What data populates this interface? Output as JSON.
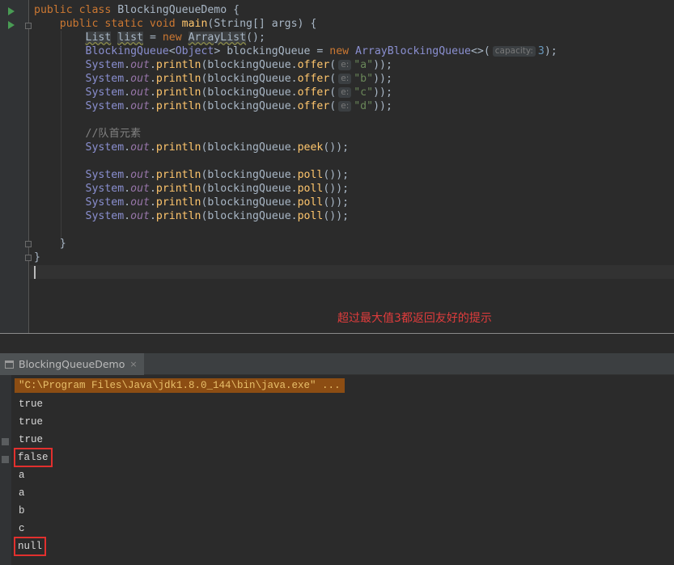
{
  "editor": {
    "lines": [
      {
        "parts": [
          [
            "kw",
            "public class "
          ],
          [
            "type",
            "BlockingQueueDemo "
          ],
          [
            "type",
            "{"
          ]
        ]
      },
      {
        "parts": [
          [
            "kw",
            "    public static void "
          ],
          [
            "method",
            "main"
          ],
          [
            "type",
            "("
          ],
          [
            "type",
            "String"
          ],
          [
            "type",
            "[] args) {"
          ]
        ]
      },
      {
        "parts": [
          [
            "type",
            "        "
          ],
          [
            "warn",
            "List"
          ],
          [
            "type",
            " "
          ],
          [
            "warn",
            "list"
          ],
          [
            "type",
            " = "
          ],
          [
            "kw",
            "new "
          ],
          [
            "warn",
            "ArrayList"
          ],
          [
            "type",
            "();"
          ]
        ]
      },
      {
        "parts": [
          [
            "type",
            "        "
          ],
          [
            "cls",
            "BlockingQueue"
          ],
          [
            "type",
            "<"
          ],
          [
            "gen",
            "Object"
          ],
          [
            "type",
            "> blockingQueue = "
          ],
          [
            "kw",
            "new "
          ],
          [
            "cls",
            "ArrayBlockingQueue"
          ],
          [
            "type",
            "<>("
          ],
          [
            "hint",
            "capacity:"
          ],
          [
            "num",
            "3"
          ],
          [
            "type",
            ");"
          ]
        ]
      },
      {
        "parts": [
          [
            "type",
            "        "
          ],
          [
            "cls",
            "System"
          ],
          [
            "type",
            "."
          ],
          [
            "field",
            "out"
          ],
          [
            "type",
            "."
          ],
          [
            "method",
            "println"
          ],
          [
            "type",
            "(blockingQueue."
          ],
          [
            "method",
            "offer"
          ],
          [
            "type",
            "("
          ],
          [
            "hint",
            "e:"
          ],
          [
            "str",
            "\"a\""
          ],
          [
            "type",
            "));"
          ]
        ]
      },
      {
        "parts": [
          [
            "type",
            "        "
          ],
          [
            "cls",
            "System"
          ],
          [
            "type",
            "."
          ],
          [
            "field",
            "out"
          ],
          [
            "type",
            "."
          ],
          [
            "method",
            "println"
          ],
          [
            "type",
            "(blockingQueue."
          ],
          [
            "method",
            "offer"
          ],
          [
            "type",
            "("
          ],
          [
            "hint",
            "e:"
          ],
          [
            "str",
            "\"b\""
          ],
          [
            "type",
            "));"
          ]
        ]
      },
      {
        "parts": [
          [
            "type",
            "        "
          ],
          [
            "cls",
            "System"
          ],
          [
            "type",
            "."
          ],
          [
            "field",
            "out"
          ],
          [
            "type",
            "."
          ],
          [
            "method",
            "println"
          ],
          [
            "type",
            "(blockingQueue."
          ],
          [
            "method",
            "offer"
          ],
          [
            "type",
            "("
          ],
          [
            "hint",
            "e:"
          ],
          [
            "str",
            "\"c\""
          ],
          [
            "type",
            "));"
          ]
        ]
      },
      {
        "parts": [
          [
            "type",
            "        "
          ],
          [
            "cls",
            "System"
          ],
          [
            "type",
            "."
          ],
          [
            "field",
            "out"
          ],
          [
            "type",
            "."
          ],
          [
            "method",
            "println"
          ],
          [
            "type",
            "(blockingQueue."
          ],
          [
            "method",
            "offer"
          ],
          [
            "type",
            "("
          ],
          [
            "hint",
            "e:"
          ],
          [
            "str",
            "\"d\""
          ],
          [
            "type",
            "));"
          ]
        ]
      },
      {
        "parts": []
      },
      {
        "parts": [
          [
            "comment",
            "        //队首元素"
          ]
        ]
      },
      {
        "parts": [
          [
            "type",
            "        "
          ],
          [
            "cls",
            "System"
          ],
          [
            "type",
            "."
          ],
          [
            "field",
            "out"
          ],
          [
            "type",
            "."
          ],
          [
            "method",
            "println"
          ],
          [
            "type",
            "(blockingQueue."
          ],
          [
            "method",
            "peek"
          ],
          [
            "type",
            "());"
          ]
        ]
      },
      {
        "parts": []
      },
      {
        "parts": [
          [
            "type",
            "        "
          ],
          [
            "cls",
            "System"
          ],
          [
            "type",
            "."
          ],
          [
            "field",
            "out"
          ],
          [
            "type",
            "."
          ],
          [
            "method",
            "println"
          ],
          [
            "type",
            "(blockingQueue."
          ],
          [
            "method",
            "poll"
          ],
          [
            "type",
            "());"
          ]
        ]
      },
      {
        "parts": [
          [
            "type",
            "        "
          ],
          [
            "cls",
            "System"
          ],
          [
            "type",
            "."
          ],
          [
            "field",
            "out"
          ],
          [
            "type",
            "."
          ],
          [
            "method",
            "println"
          ],
          [
            "type",
            "(blockingQueue."
          ],
          [
            "method",
            "poll"
          ],
          [
            "type",
            "());"
          ]
        ]
      },
      {
        "parts": [
          [
            "type",
            "        "
          ],
          [
            "cls",
            "System"
          ],
          [
            "type",
            "."
          ],
          [
            "field",
            "out"
          ],
          [
            "type",
            "."
          ],
          [
            "method",
            "println"
          ],
          [
            "type",
            "(blockingQueue."
          ],
          [
            "method",
            "poll"
          ],
          [
            "type",
            "());"
          ]
        ]
      },
      {
        "parts": [
          [
            "type",
            "        "
          ],
          [
            "cls",
            "System"
          ],
          [
            "type",
            "."
          ],
          [
            "field",
            "out"
          ],
          [
            "type",
            "."
          ],
          [
            "method",
            "println"
          ],
          [
            "type",
            "(blockingQueue."
          ],
          [
            "method",
            "poll"
          ],
          [
            "type",
            "());"
          ]
        ]
      },
      {
        "parts": []
      },
      {
        "parts": [
          [
            "type",
            "    }"
          ]
        ]
      },
      {
        "parts": [
          [
            "type",
            "}"
          ]
        ]
      }
    ]
  },
  "annotation": "超过最大值3都返回友好的提示",
  "run_panel": {
    "tab_label": "BlockingQueueDemo",
    "close_glyph": "×",
    "command": "\"C:\\Program Files\\Java\\jdk1.8.0_144\\bin\\java.exe\" ...",
    "output": [
      {
        "text": "true",
        "boxed": false
      },
      {
        "text": "true",
        "boxed": false
      },
      {
        "text": "true",
        "boxed": false
      },
      {
        "text": "false",
        "boxed": true
      },
      {
        "text": "a",
        "boxed": false
      },
      {
        "text": "a",
        "boxed": false
      },
      {
        "text": "b",
        "boxed": false
      },
      {
        "text": "c",
        "boxed": false
      },
      {
        "text": "null",
        "boxed": true
      }
    ]
  },
  "colors": {
    "keyword": "#cc7832",
    "method": "#ffc66d",
    "string": "#6a8759",
    "number": "#6897bb",
    "static_field": "#9876aa",
    "highlight_box": "#e2302e",
    "annotation": "#e03c3c"
  }
}
